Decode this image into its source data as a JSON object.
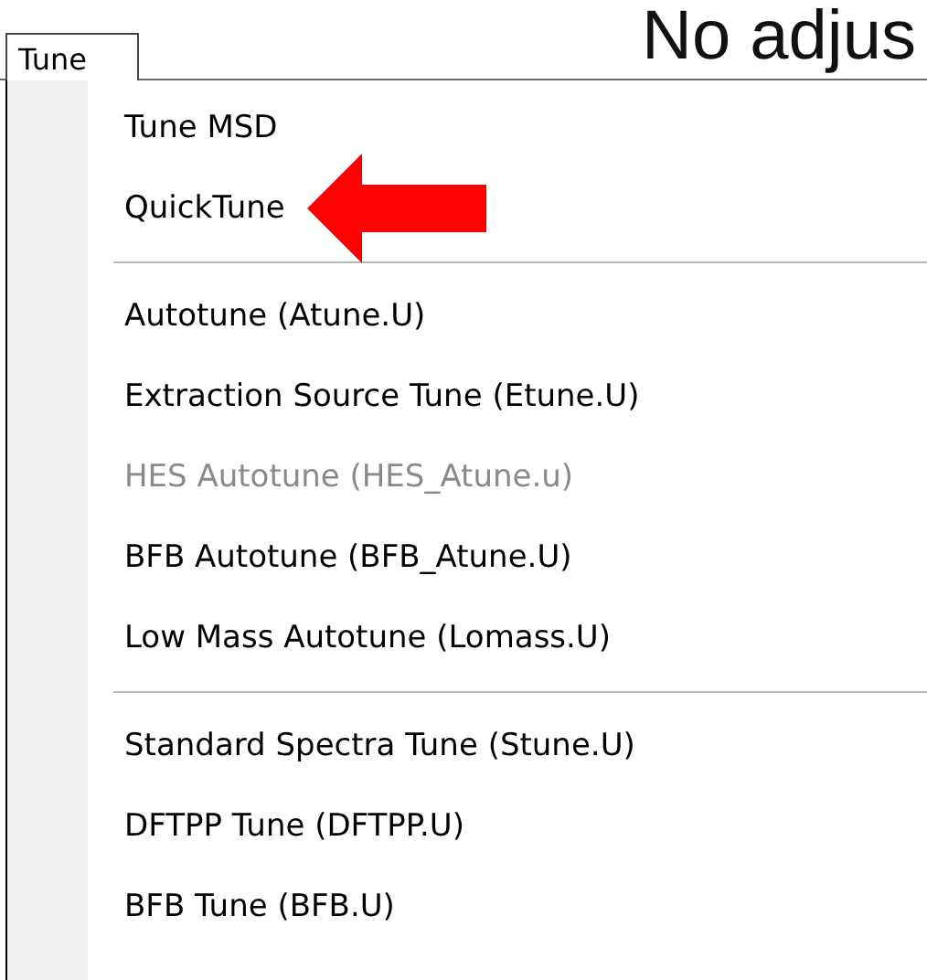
{
  "caption": "No adjus",
  "tab": {
    "label": "Tune",
    "selected": true
  },
  "menu": [
    {
      "kind": "item",
      "label": "Tune MSD",
      "disabled": false,
      "arrow": false
    },
    {
      "kind": "item",
      "label": "QuickTune",
      "disabled": false,
      "arrow": true
    },
    {
      "kind": "separator"
    },
    {
      "kind": "item",
      "label": "Autotune (Atune.U)",
      "disabled": false,
      "arrow": false
    },
    {
      "kind": "item",
      "label": "Extraction Source Tune (Etune.U)",
      "disabled": false,
      "arrow": false
    },
    {
      "kind": "item",
      "label": "HES Autotune (HES_Atune.u)",
      "disabled": true,
      "arrow": false
    },
    {
      "kind": "item",
      "label": "BFB Autotune (BFB_Atune.U)",
      "disabled": false,
      "arrow": false
    },
    {
      "kind": "item",
      "label": "Low Mass Autotune (Lomass.U)",
      "disabled": false,
      "arrow": false
    },
    {
      "kind": "separator"
    },
    {
      "kind": "item",
      "label": "Standard Spectra Tune (Stune.U)",
      "disabled": false,
      "arrow": false
    },
    {
      "kind": "item",
      "label": "DFTPP Tune (DFTPP.U)",
      "disabled": false,
      "arrow": false
    },
    {
      "kind": "item",
      "label": "BFB Tune (BFB.U)",
      "disabled": false,
      "arrow": false
    }
  ]
}
